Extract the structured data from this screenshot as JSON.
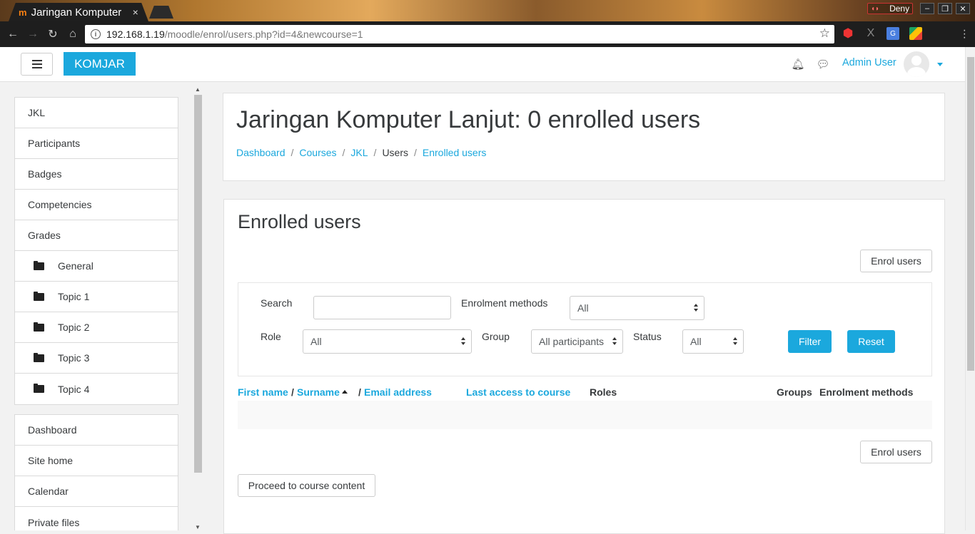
{
  "browser": {
    "tab_favicon": "m",
    "tab_title": "Jaringan Komputer",
    "tab_close": "×",
    "profile_name": "Deny",
    "url_host": "192.168.1.19",
    "url_path": "/moodle/enrol/users.php?id=4&newcourse=1",
    "icons": [
      "back-icon",
      "forward-icon",
      "reload-icon",
      "home-icon",
      "info-icon",
      "star-icon",
      "opera-icon",
      "x-extension-icon",
      "translate-icon",
      "drive-icon",
      "menu-dots-icon"
    ]
  },
  "header": {
    "brand": "KOMJAR",
    "user_name": "Admin User",
    "icons": [
      "menu-icon",
      "bell-icon",
      "chat-icon",
      "avatar",
      "caret-down-icon"
    ]
  },
  "drawer": {
    "course_items": [
      {
        "label": "JKL",
        "folder": false
      },
      {
        "label": "Participants",
        "folder": false
      },
      {
        "label": "Badges",
        "folder": false
      },
      {
        "label": "Competencies",
        "folder": false
      },
      {
        "label": "Grades",
        "folder": false
      },
      {
        "label": "General",
        "folder": true
      },
      {
        "label": "Topic 1",
        "folder": true
      },
      {
        "label": "Topic 2",
        "folder": true
      },
      {
        "label": "Topic 3",
        "folder": true
      },
      {
        "label": "Topic 4",
        "folder": true
      }
    ],
    "site_items": [
      "Dashboard",
      "Site home",
      "Calendar",
      "Private files"
    ]
  },
  "page": {
    "title": "Jaringan Komputer Lanjut: 0 enrolled users",
    "breadcrumb": [
      {
        "label": "Dashboard",
        "link": true
      },
      {
        "label": "Courses",
        "link": true
      },
      {
        "label": "JKL",
        "link": true
      },
      {
        "label": "Users",
        "link": false
      },
      {
        "label": "Enrolled users",
        "link": true
      }
    ],
    "breadcrumb_sep": "/"
  },
  "enrolled": {
    "heading": "Enrolled users",
    "enrol_button": "Enrol users",
    "proceed_button": "Proceed to course content",
    "filters": {
      "search_label": "Search",
      "search_value": "",
      "methods_label": "Enrolment methods",
      "methods_value": "All",
      "role_label": "Role",
      "role_value": "All",
      "group_label": "Group",
      "group_value": "All participants",
      "status_label": "Status",
      "status_value": "All",
      "filter_button": "Filter",
      "reset_button": "Reset"
    },
    "columns": {
      "first_name": "First name",
      "sep1": "/",
      "surname": "Surname",
      "sep2": "/",
      "email": "Email address",
      "last_access": "Last access to course",
      "roles": "Roles",
      "groups": "Groups",
      "methods": "Enrolment methods"
    },
    "rows": []
  },
  "colors": {
    "accent": "#1ba8dd",
    "text": "#373a3c"
  }
}
